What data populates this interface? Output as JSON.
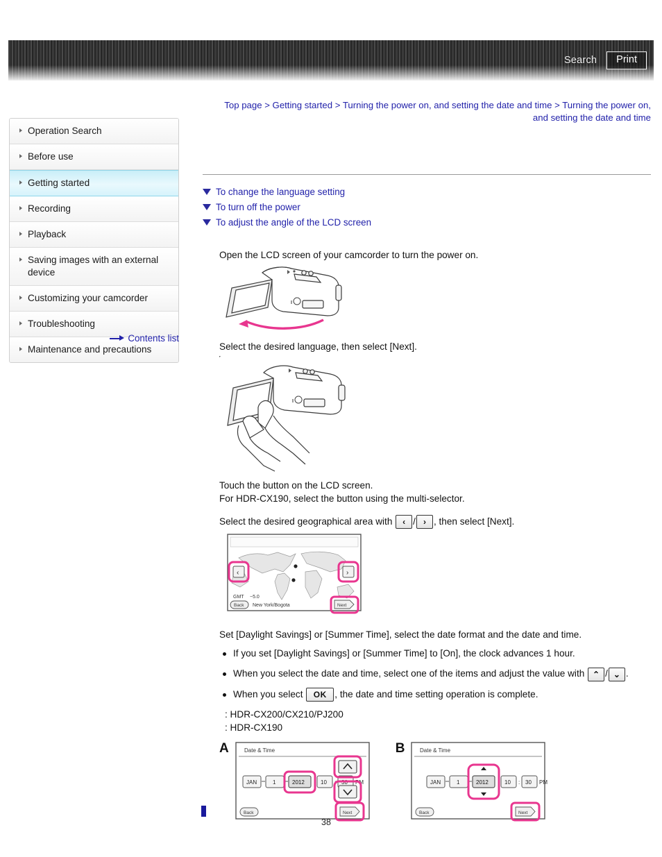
{
  "header": {
    "search_label": "Search",
    "print_label": "Print"
  },
  "breadcrumb": {
    "text": "Top page > Getting started > Turning the power on, and setting the date and time > Turning the power on, and setting the date and time"
  },
  "sidebar": {
    "items": [
      {
        "label": "Operation Search",
        "active": false
      },
      {
        "label": "Before use",
        "active": false
      },
      {
        "label": "Getting started",
        "active": true
      },
      {
        "label": "Recording",
        "active": false
      },
      {
        "label": "Playback",
        "active": false
      },
      {
        "label": "Saving images with an external device",
        "active": false
      },
      {
        "label": "Customizing your camcorder",
        "active": false
      },
      {
        "label": "Troubleshooting",
        "active": false
      },
      {
        "label": "Maintenance and precautions",
        "active": false
      }
    ],
    "contents_link": "Contents list"
  },
  "toc_links": [
    "To change the language setting",
    "To turn off the power",
    "To adjust the angle of the LCD screen"
  ],
  "steps": {
    "step1": "Open the LCD screen of your camcorder to turn the power on.",
    "step2": "Select the desired language, then select [Next].",
    "note1": "Touch the button on the LCD screen.",
    "note2": "For HDR-CX190, select the button using the multi-selector.",
    "step3_pre": "Select the desired geographical area with ",
    "step3_key_left": "‹",
    "step3_key_right": "›",
    "step3_post": ", then select [Next].",
    "step4": "Set [Daylight Savings] or [Summer Time], select the date format and the date and time.",
    "bullets": [
      "If you set [Daylight Savings] or [Summer Time] to [On], the clock advances 1 hour.",
      "When you select the date and time, select one of the items and adjust the value with ",
      "When you select "
    ],
    "bullet2_post": ".",
    "bullet3_post": ", the date and time setting operation is complete.",
    "key_up": "⌃",
    "key_down": "⌄",
    "key_ok": "OK",
    "model_a": ": HDR-CX200/CX210/PJ200",
    "model_b": ": HDR-CX190"
  },
  "map_screen": {
    "gmt_label": "GMT",
    "gmt_value": "−5.0",
    "area": "New York/Bogota",
    "back_label": "Back",
    "next_label": "Next",
    "prev_key": "‹",
    "next_key": "›"
  },
  "datetime_screens": [
    {
      "letter": "A",
      "title": "Date & Time",
      "month": "JAN",
      "day": "1",
      "year": "2012",
      "hour": "10",
      "minute": "30",
      "meridiem": "PM",
      "back_label": "Back",
      "next_label": "Next",
      "up_key": "⌃",
      "down_key": "⌄",
      "style": "side-arrows"
    },
    {
      "letter": "B",
      "title": "Date & Time",
      "month": "JAN",
      "day": "1",
      "year": "2012",
      "hour": "10",
      "minute": "30",
      "meridiem": "PM",
      "back_label": "Back",
      "next_label": "Next",
      "up_key": "▲",
      "down_key": "▼",
      "style": "inline-arrows"
    }
  ],
  "footer": {
    "page_number": "38"
  },
  "colors": {
    "link": "#2222aa",
    "highlight_pink": "#e8368f",
    "active_sidebar": "#c9eef8"
  }
}
